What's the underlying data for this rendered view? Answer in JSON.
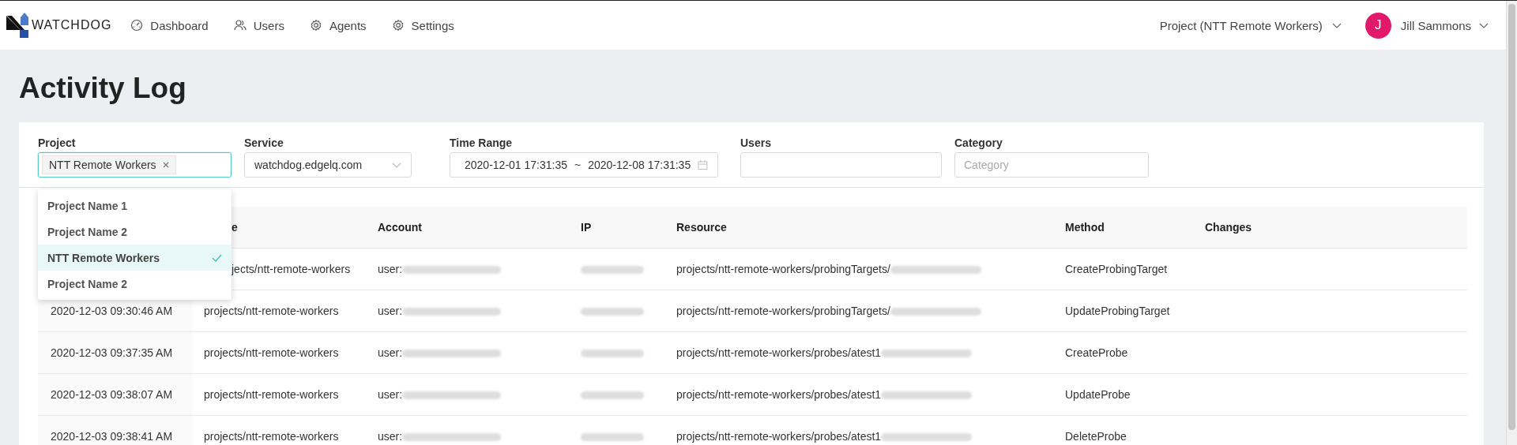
{
  "nav": {
    "logo": "WATCHDOG",
    "items": [
      {
        "label": "Dashboard"
      },
      {
        "label": "Users"
      },
      {
        "label": "Agents"
      },
      {
        "label": "Settings"
      }
    ],
    "project": "Project (NTT Remote Workers)",
    "user": {
      "initial": "J",
      "name": "Jill Sammons"
    }
  },
  "title": "Activity Log",
  "filters": [
    {
      "kind": "tags",
      "label": "Project",
      "tags": [
        "NTT Remote Workers"
      ],
      "focused": true
    },
    {
      "kind": "select",
      "label": "Service",
      "value": "watchdog.edgelq.com"
    },
    {
      "kind": "range",
      "label": "Time Range",
      "from": "2020-12-01 17:31:35",
      "sep": "~",
      "to": "2020-12-08 17:31:35"
    },
    {
      "kind": "text",
      "label": "Users"
    },
    {
      "kind": "text",
      "label": "Category",
      "placeholder": "Category"
    }
  ],
  "project_menu": [
    {
      "label": "Project Name 1",
      "selected": false
    },
    {
      "label": "Project Name 2",
      "selected": false
    },
    {
      "label": "NTT Remote Workers",
      "selected": true
    },
    {
      "label": "Project Name 2",
      "selected": false
    }
  ],
  "table": {
    "columns": [
      {},
      {
        "label": "e",
        "partly_covered": true
      },
      {
        "label": "Account"
      },
      {
        "label": "IP"
      },
      {
        "label": "Resource"
      },
      {
        "label": "Method"
      },
      {
        "label": "Changes"
      }
    ],
    "rows": [
      {
        "cells": [
          {},
          {
            "text": "jects/ntt-remote-workers",
            "partly_covered": true
          },
          {
            "text": "user:",
            "redacted": true
          },
          {
            "redacted": true
          },
          {
            "text": "projects/ntt-remote-workers/probingTargets/",
            "redacted": true
          },
          {
            "text": "CreateProbingTarget"
          },
          {}
        ]
      },
      {
        "cells": [
          {
            "text": "2020-12-03 09:30:46 AM"
          },
          {
            "text": "projects/ntt-remote-workers"
          },
          {
            "text": "user:",
            "redacted": true
          },
          {
            "redacted": true
          },
          {
            "text": "projects/ntt-remote-workers/probingTargets/",
            "redacted": true
          },
          {
            "text": "UpdateProbingTarget"
          },
          {}
        ]
      },
      {
        "cells": [
          {
            "text": "2020-12-03 09:37:35 AM"
          },
          {
            "text": "projects/ntt-remote-workers"
          },
          {
            "text": "user:",
            "redacted": true
          },
          {
            "redacted": true
          },
          {
            "text": "projects/ntt-remote-workers/probes/atest1",
            "redacted": true
          },
          {
            "text": "CreateProbe"
          },
          {}
        ]
      },
      {
        "cells": [
          {
            "text": "2020-12-03 09:38:07 AM"
          },
          {
            "text": "projects/ntt-remote-workers"
          },
          {
            "text": "user:",
            "redacted": true
          },
          {
            "redacted": true
          },
          {
            "text": "projects/ntt-remote-workers/probes/atest1",
            "redacted": true
          },
          {
            "text": "UpdateProbe"
          },
          {}
        ]
      },
      {
        "cells": [
          {
            "text": "2020-12-03 09:38:41 AM"
          },
          {
            "text": "projects/ntt-remote-workers"
          },
          {
            "text": "user:",
            "redacted": true
          },
          {
            "redacted": true
          },
          {
            "text": "projects/ntt-remote-workers/probes/atest1",
            "redacted": true
          },
          {
            "text": "DeleteProbe"
          },
          {}
        ]
      }
    ]
  }
}
